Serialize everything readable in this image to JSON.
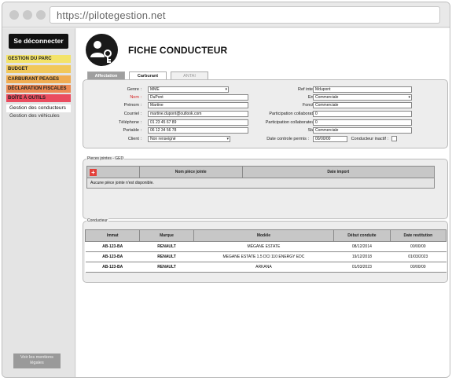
{
  "browser": {
    "url": "https://pilotegestion.net"
  },
  "sidebar": {
    "logout_label": "Se déconnecter",
    "menu": [
      {
        "label": "GESTION DU PARC",
        "color": "#f3e36a"
      },
      {
        "label": "BUDGET",
        "color": "#f1c85a"
      },
      {
        "label": "CARBURANT PEAGES",
        "color": "#f0ad52"
      },
      {
        "label": "DÉCLARATION FISCALES",
        "color": "#ec8a53"
      },
      {
        "label": "BOÎTE À OUTILS",
        "color": "#ea4c5f"
      }
    ],
    "submenu": [
      {
        "label": "Gestion des conducteurs",
        "active": true
      },
      {
        "label": "Gestion des véhicules",
        "active": false
      }
    ],
    "legal_label": "Voir les mentions légales"
  },
  "header": {
    "title": "FICHE CONDUCTEUR",
    "icon": "driver-key-icon"
  },
  "tabs": [
    {
      "label": "Affectation",
      "state": "selected"
    },
    {
      "label": "Carburant",
      "state": "normal"
    },
    {
      "label": "ANTAI",
      "state": "disabled"
    }
  ],
  "form": {
    "left": [
      {
        "label": "Genre :",
        "value": "MME",
        "type": "select"
      },
      {
        "label": "Nom :",
        "value": "DuPont",
        "type": "text",
        "required": true
      },
      {
        "label": "Prénom :",
        "value": "Martine",
        "type": "text"
      },
      {
        "label": "Courriel :",
        "value": "martine.dupont@outlook.com",
        "type": "text"
      },
      {
        "label": "Téléphone :",
        "value": "01 23 45 67 89",
        "type": "text"
      },
      {
        "label": "Portable :",
        "value": "06 12 34 56 78",
        "type": "text"
      },
      {
        "label": "Client :",
        "value": "Non renseigné",
        "type": "select"
      }
    ],
    "right": [
      {
        "label": "Ref interne :",
        "value": "Mdupont",
        "type": "text"
      },
      {
        "label": "Entité :",
        "value": "Commerciale",
        "type": "select"
      },
      {
        "label": "Fonction :",
        "value": "Commerciale",
        "type": "text"
      },
      {
        "label": "Participation collaborateur :",
        "value": "0",
        "type": "text"
      },
      {
        "label": "Participation collaborateur 2 :",
        "value": "0",
        "type": "text"
      },
      {
        "label": "Statut :",
        "value": "Commerciale",
        "type": "text"
      }
    ],
    "date_controle_label": "Date controle permis :",
    "date_controle_value": "00/00/00",
    "inactive_label": "Conducteur inactif :"
  },
  "documents": {
    "title": "Pieces jointes - GED",
    "columns": [
      "Nom pièce jointe",
      "Date import"
    ],
    "empty_message": "Aucune pièce jointe n'est disponible."
  },
  "vehicles": {
    "title": "Conducteur",
    "columns": [
      "Immat",
      "Marque",
      "Modèle",
      "Début conduite",
      "Date restitution"
    ],
    "rows": [
      [
        "AB-123-BA",
        "RENAULT",
        "MÉGANE ESTATE",
        "08/12/2014",
        "00/00/00"
      ],
      [
        "AB-123-BA",
        "RENAULT",
        "MEGANE ESTATE 1.5 DCI 110 ENERGY EDC",
        "19/12/2018",
        "01/03/2023"
      ],
      [
        "AB-123-BA",
        "RENAULT",
        "ARKANA",
        "01/03/2023",
        "00/00/00"
      ]
    ]
  }
}
